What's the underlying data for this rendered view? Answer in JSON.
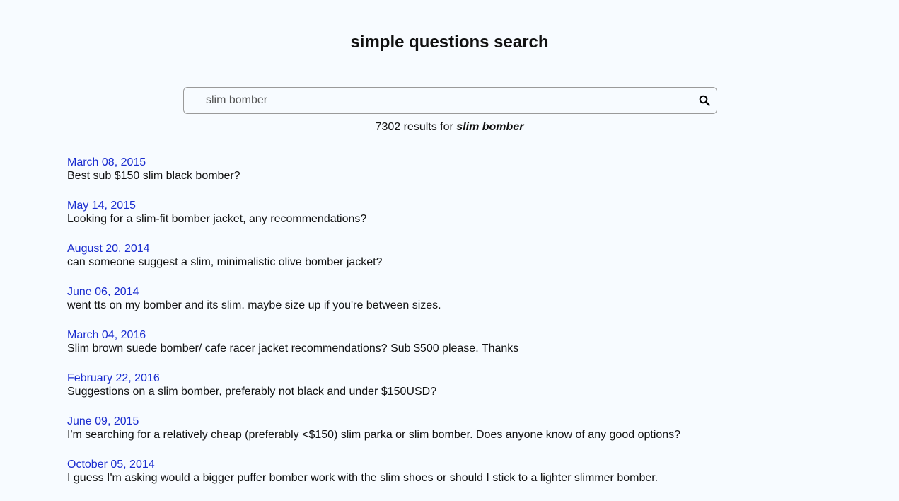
{
  "header": {
    "title": "simple questions search"
  },
  "search": {
    "value": "slim bomber",
    "icon": "search-icon"
  },
  "summary": {
    "count": "7302",
    "prefix": "results for",
    "query": "slim bomber"
  },
  "results": [
    {
      "date": "March 08, 2015",
      "text": "Best sub $150 slim black bomber?"
    },
    {
      "date": "May 14, 2015",
      "text": "Looking for a slim-fit bomber jacket, any recommendations?"
    },
    {
      "date": "August 20, 2014",
      "text": "can someone suggest a slim, minimalistic olive bomber jacket?"
    },
    {
      "date": "June 06, 2014",
      "text": "went tts on my bomber and its slim. maybe size up if you're between sizes."
    },
    {
      "date": "March 04, 2016",
      "text": "Slim brown suede bomber/ cafe racer jacket recommendations? Sub $500 please. Thanks"
    },
    {
      "date": "February 22, 2016",
      "text": "Suggestions on a slim bomber, preferably not black and under $150USD?"
    },
    {
      "date": "June 09, 2015",
      "text": "I'm searching for a relatively cheap (preferably <$150) slim parka or slim bomber. Does anyone know of any good options?"
    },
    {
      "date": "October 05, 2014",
      "text": "I guess I'm asking would a bigger puffer bomber work with the slim shoes or should I stick to a lighter slimmer bomber."
    }
  ],
  "colors": {
    "background": "#f7fbff",
    "link": "#1a2ccf",
    "text": "#111111"
  }
}
